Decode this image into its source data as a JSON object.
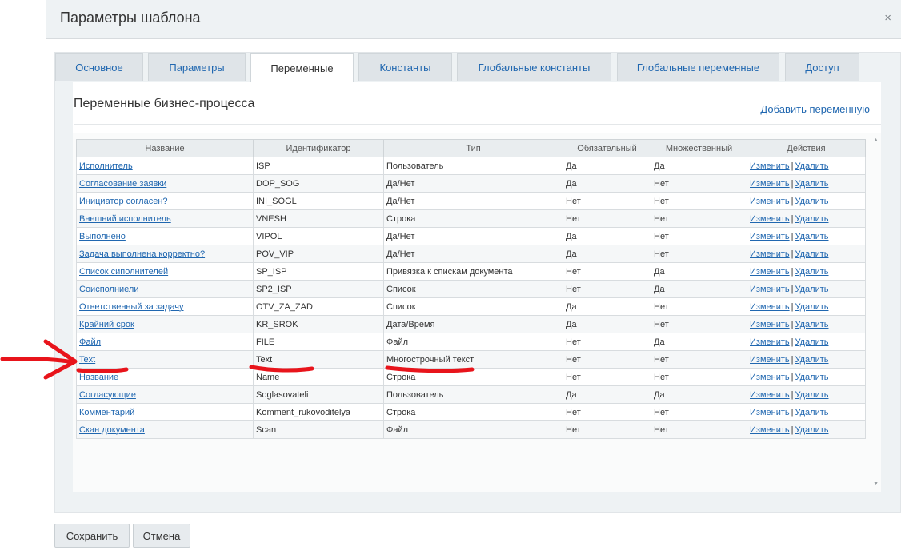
{
  "dialog": {
    "title": "Параметры шаблона",
    "close_glyph": "×"
  },
  "tabs": [
    {
      "label": "Основное",
      "active": false
    },
    {
      "label": "Параметры",
      "active": false
    },
    {
      "label": "Переменные",
      "active": true
    },
    {
      "label": "Константы",
      "active": false
    },
    {
      "label": "Глобальные константы",
      "active": false
    },
    {
      "label": "Глобальные переменные",
      "active": false
    },
    {
      "label": "Доступ",
      "active": false
    }
  ],
  "section": {
    "title": "Переменные бизнес-процесса",
    "add_link": "Добавить переменную"
  },
  "table": {
    "headers": [
      "Название",
      "Идентификатор",
      "Тип",
      "Обязательный",
      "Множественный",
      "Действия"
    ],
    "actions": {
      "edit": "Изменить",
      "separator": "|",
      "delete": "Удалить"
    },
    "rows": [
      {
        "name": "Исполнитель",
        "id": "ISP",
        "type": "Пользователь",
        "required": "Да",
        "multiple": "Да"
      },
      {
        "name": "Согласование заявки",
        "id": "DOP_SOG",
        "type": "Да/Нет",
        "required": "Да",
        "multiple": "Нет"
      },
      {
        "name": "Инициатор согласен?",
        "id": "INI_SOGL",
        "type": "Да/Нет",
        "required": "Нет",
        "multiple": "Нет"
      },
      {
        "name": "Внешний исполнитель",
        "id": "VNESH",
        "type": "Строка",
        "required": "Нет",
        "multiple": "Нет"
      },
      {
        "name": "Выполнено",
        "id": "VIPOL",
        "type": "Да/Нет",
        "required": "Да",
        "multiple": "Нет"
      },
      {
        "name": "Задача выполнена корректно?",
        "id": "POV_VIP",
        "type": "Да/Нет",
        "required": "Да",
        "multiple": "Нет"
      },
      {
        "name": "Список сиполнителей",
        "id": "SP_ISP",
        "type": "Привязка к спискам документа",
        "required": "Нет",
        "multiple": "Да"
      },
      {
        "name": "Соисполниели",
        "id": "SP2_ISP",
        "type": "Список",
        "required": "Нет",
        "multiple": "Да"
      },
      {
        "name": "Ответственный за задачу",
        "id": "OTV_ZA_ZAD",
        "type": "Список",
        "required": "Да",
        "multiple": "Нет"
      },
      {
        "name": "Крайний срок",
        "id": "KR_SROK",
        "type": "Дата/Время",
        "required": "Да",
        "multiple": "Нет"
      },
      {
        "name": "Файл",
        "id": "FILE",
        "type": "Файл",
        "required": "Нет",
        "multiple": "Да"
      },
      {
        "name": "Text",
        "id": "Text",
        "type": "Многострочный текст",
        "required": "Нет",
        "multiple": "Нет"
      },
      {
        "name": "Название",
        "id": "Name",
        "type": "Строка",
        "required": "Нет",
        "multiple": "Нет"
      },
      {
        "name": "Согласующие",
        "id": "Soglasovateli",
        "type": "Пользователь",
        "required": "Да",
        "multiple": "Да"
      },
      {
        "name": "Комментарий",
        "id": "Komment_rukovoditelya",
        "type": "Строка",
        "required": "Нет",
        "multiple": "Нет"
      },
      {
        "name": "Скан документа",
        "id": "Scan",
        "type": "Файл",
        "required": "Нет",
        "multiple": "Нет"
      }
    ]
  },
  "buttons": {
    "save": "Сохранить",
    "cancel": "Отмена"
  },
  "colors": {
    "link": "#2067b0",
    "annotation": "#e8141b",
    "header_bg": "#eef2f4"
  }
}
